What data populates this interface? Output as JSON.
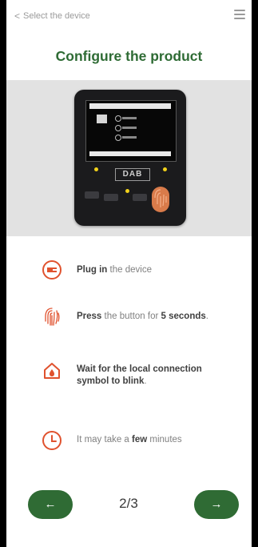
{
  "header": {
    "back_label": "Select the device",
    "back_icon": "chevron-left-icon",
    "menu_icon": "hamburger-menu-icon"
  },
  "page": {
    "title": "Configure the product"
  },
  "device": {
    "logo_text": "DAB"
  },
  "steps": [
    {
      "icon": "plug-icon",
      "bold": "Plug in",
      "rest": " the device"
    },
    {
      "icon": "fingerprint-icon",
      "bold": "Press",
      "rest": " the button for ",
      "bold2": "5 seconds",
      "tail": "."
    },
    {
      "icon": "house-drop-icon",
      "bold": "Wait for the local connection symbol to blink",
      "rest": "."
    },
    {
      "icon": "clock-icon",
      "pre": "It may take a ",
      "bold": "few",
      "rest": " minutes"
    }
  ],
  "footer": {
    "pager": "2/3",
    "prev_icon": "arrow-left-icon",
    "next_icon": "arrow-right-icon"
  },
  "colors": {
    "brand_green": "#2e6b34",
    "accent_orange": "#e0522e"
  }
}
